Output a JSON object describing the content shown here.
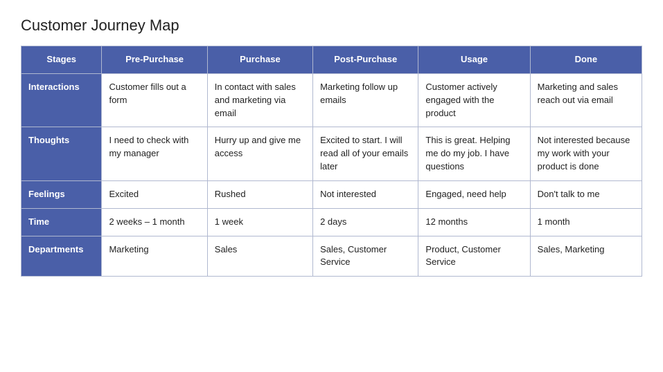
{
  "page": {
    "title": "Customer Journey Map"
  },
  "table": {
    "headers": [
      "Stages",
      "Pre-Purchase",
      "Purchase",
      "Post-Purchase",
      "Usage",
      "Done"
    ],
    "rows": [
      {
        "label": "Interactions",
        "cells": [
          "Customer fills out a form",
          "In contact with sales and marketing via email",
          "Marketing follow up emails",
          "Customer actively engaged with the product",
          "Marketing and sales reach out via email"
        ]
      },
      {
        "label": "Thoughts",
        "cells": [
          "I need to check with my manager",
          "Hurry up and give me access",
          "Excited to start. I will read all of your emails later",
          "This is great. Helping me do my job. I have questions",
          "Not interested because my work with your product is done"
        ]
      },
      {
        "label": "Feelings",
        "cells": [
          "Excited",
          "Rushed",
          "Not interested",
          "Engaged, need help",
          "Don't talk to me"
        ]
      },
      {
        "label": "Time",
        "cells": [
          "2 weeks – 1 month",
          "1 week",
          "2 days",
          "12 months",
          "1 month"
        ]
      },
      {
        "label": "Departments",
        "cells": [
          "Marketing",
          "Sales",
          "Sales, Customer Service",
          "Product, Customer Service",
          "Sales, Marketing"
        ]
      }
    ]
  }
}
